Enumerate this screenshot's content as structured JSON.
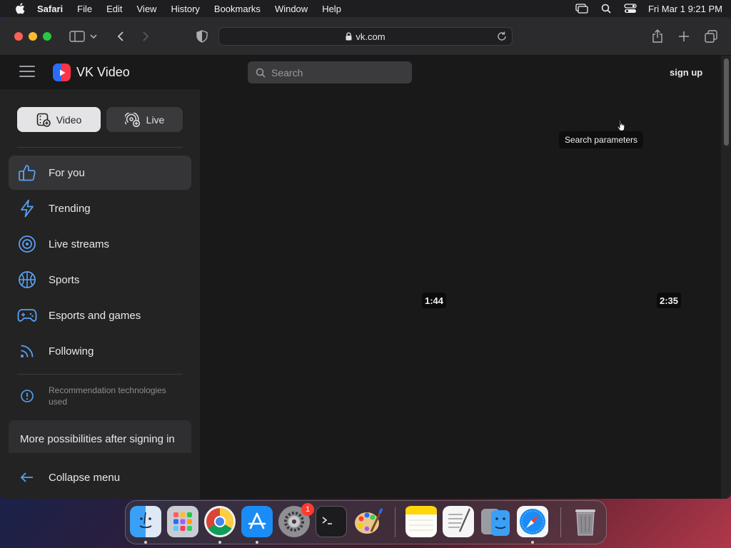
{
  "menubar": {
    "app_name": "Safari",
    "items": [
      "File",
      "Edit",
      "View",
      "History",
      "Bookmarks",
      "Window",
      "Help"
    ],
    "clock": "Fri Mar 1  9:21 PM"
  },
  "browser": {
    "url": "vk.com"
  },
  "header": {
    "logo_text": "VK Video",
    "search_placeholder": "Search",
    "signup_label": "sign up"
  },
  "sidebar": {
    "tabs": [
      {
        "label": "Video",
        "icon": "video-library-icon",
        "selected": true
      },
      {
        "label": "Live",
        "icon": "live-broadcast-icon",
        "selected": false
      }
    ],
    "nav": [
      {
        "label": "For you",
        "icon": "thumbs-up-icon",
        "active": true
      },
      {
        "label": "Trending",
        "icon": "lightning-icon",
        "active": false
      },
      {
        "label": "Live streams",
        "icon": "live-circle-icon",
        "active": false
      },
      {
        "label": "Sports",
        "icon": "basketball-icon",
        "active": false
      },
      {
        "label": "Esports and games",
        "icon": "gamepad-icon",
        "active": false
      },
      {
        "label": "Following",
        "icon": "rss-icon",
        "active": false
      }
    ],
    "recommendation_note": "Recommendation technologies used",
    "more_possibilities": "More possibilities after signing in",
    "collapse_label": "Collapse menu"
  },
  "main": {
    "durations": [
      "1:44",
      "2:35"
    ],
    "tooltip": "Search parameters"
  },
  "dock": {
    "apps": [
      "Finder",
      "Launchpad",
      "Chrome",
      "App Store",
      "System Settings",
      "Terminal",
      "Paintbrush",
      "Notes",
      "TextEdit",
      "Migration Assistant",
      "Safari",
      "Trash"
    ],
    "settings_badge": "1"
  },
  "colors": {
    "accent_red": "#ff3347",
    "accent_blue": "#2b6cf6",
    "icon_blue": "#5aa0f0"
  }
}
